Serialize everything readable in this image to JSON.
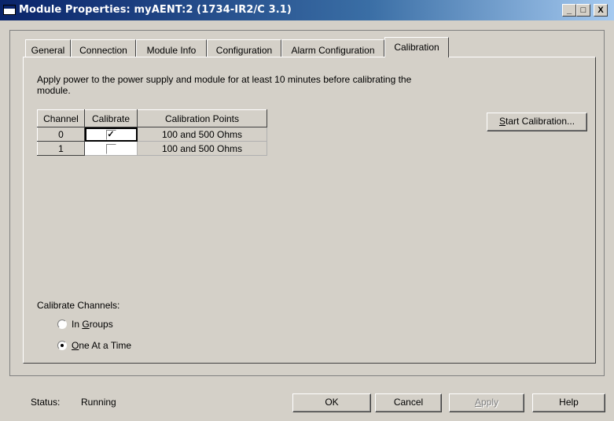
{
  "window": {
    "title": "Module Properties: myAENT:2 (1734-IR2/C 3.1)",
    "controls": {
      "minimize": "_",
      "maximize": "□",
      "close": "X"
    }
  },
  "tabs": [
    {
      "label": "General",
      "active": false
    },
    {
      "label": "Connection",
      "active": false
    },
    {
      "label": "Module Info",
      "active": false
    },
    {
      "label": "Configuration",
      "active": false
    },
    {
      "label": "Alarm Configuration",
      "active": false
    },
    {
      "label": "Calibration",
      "active": true
    }
  ],
  "calibration": {
    "instructions": "Apply power to the power supply and module for at least 10 minutes before calibrating the module.",
    "table": {
      "headers": [
        "Channel",
        "Calibrate",
        "Calibration Points"
      ],
      "rows": [
        {
          "channel": "0",
          "calibrate": true,
          "points": "100 and 500 Ohms"
        },
        {
          "channel": "1",
          "calibrate": false,
          "points": "100 and 500 Ohms"
        }
      ]
    },
    "start_button": {
      "mnemonic": "S",
      "rest": "tart Calibration..."
    },
    "group_label": "Calibrate Channels:",
    "options": [
      {
        "mnemonic": "",
        "pre": "In ",
        "mn": "G",
        "rest": "roups",
        "checked": false
      },
      {
        "mnemonic": "",
        "pre": "",
        "mn": "O",
        "rest": "ne At a Time",
        "checked": true
      }
    ]
  },
  "status": {
    "label": "Status:",
    "value": "Running"
  },
  "buttons": {
    "ok": "OK",
    "cancel": "Cancel",
    "apply": {
      "mn": "A",
      "rest": "pply",
      "enabled": false
    },
    "help": "Help"
  }
}
